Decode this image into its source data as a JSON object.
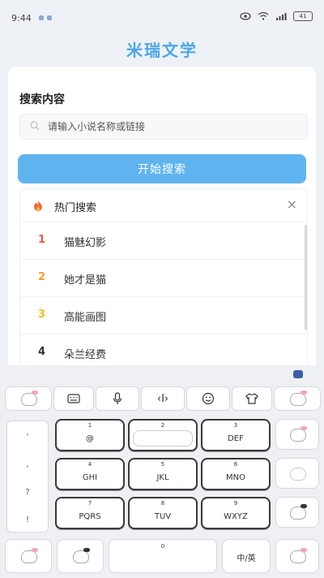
{
  "status_bar": {
    "time": "9:44",
    "battery": "41"
  },
  "app": {
    "title": "米瑞文学"
  },
  "search": {
    "heading": "搜索内容",
    "placeholder": "请输入小说名称或链接",
    "button_label": "开始搜索"
  },
  "hot": {
    "title": "热门搜索",
    "close": "×",
    "items": [
      {
        "rank": "1",
        "label": "猫魅幻影",
        "color": "#e8584f"
      },
      {
        "rank": "2",
        "label": "她才是猫",
        "color": "#f0a030"
      },
      {
        "rank": "3",
        "label": "高能画图",
        "color": "#f0c020"
      },
      {
        "rank": "4",
        "label": "朵兰经费",
        "color": "#333333"
      }
    ]
  },
  "keyboard": {
    "side_symbols": [
      "'",
      ",",
      "?",
      "!"
    ],
    "cursor_label": "‹I›",
    "keys": [
      {
        "num": "1",
        "label": "@"
      },
      {
        "num": "3",
        "label": "DEF"
      },
      {
        "num": "4",
        "label": "GHI"
      },
      {
        "num": "5",
        "label": "JKL"
      },
      {
        "num": "6",
        "label": "MNO"
      },
      {
        "num": "7",
        "label": "PQRS"
      },
      {
        "num": "8",
        "label": "TUV"
      },
      {
        "num": "9",
        "label": "WXYZ"
      }
    ],
    "key2_num": "2",
    "space_num": "0",
    "lang_label": "中/英"
  }
}
